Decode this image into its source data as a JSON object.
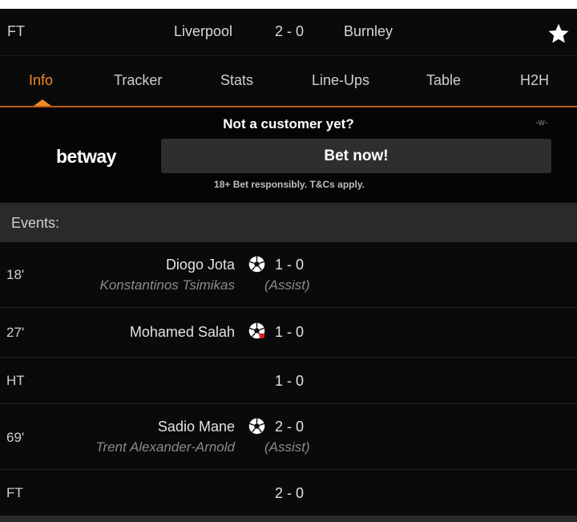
{
  "match": {
    "status": "FT",
    "home_team": "Liverpool",
    "score": "2 - 0",
    "away_team": "Burnley",
    "favorite_icon": "star-icon"
  },
  "tabs": [
    {
      "label": "Info",
      "active": true
    },
    {
      "label": "Tracker",
      "active": false
    },
    {
      "label": "Stats",
      "active": false
    },
    {
      "label": "Line-Ups",
      "active": false
    },
    {
      "label": "Table",
      "active": false
    },
    {
      "label": "H2H",
      "active": false
    }
  ],
  "ad": {
    "headline": "Not a customer yet?",
    "tag": "-w-",
    "brand": "betway",
    "cta": "Bet now!",
    "disclaimer": "18+ Bet responsibly. T&Cs apply."
  },
  "events": {
    "header": "Events:",
    "items": [
      {
        "minute": "18'",
        "player": "Diogo Jota",
        "assist_player": "Konstantinos Tsimikas",
        "score": "1 - 0",
        "assist_label": "(Assist)",
        "icon": "soccer-ball-icon"
      },
      {
        "minute": "27'",
        "player": "Mohamed Salah",
        "score": "1 - 0",
        "icon": "penalty-goal-icon"
      },
      {
        "minute": "HT",
        "score": "1 - 0"
      },
      {
        "minute": "69'",
        "player": "Sadio Mane",
        "assist_player": "Trent Alexander-Arnold",
        "score": "2 - 0",
        "assist_label": "(Assist)",
        "icon": "soccer-ball-icon"
      },
      {
        "minute": "FT",
        "score": "2 - 0"
      }
    ]
  },
  "colors": {
    "accent": "#f08a24",
    "background": "#0a0a0a",
    "section_header": "#2a2a2a",
    "button": "#2e2e2e"
  }
}
